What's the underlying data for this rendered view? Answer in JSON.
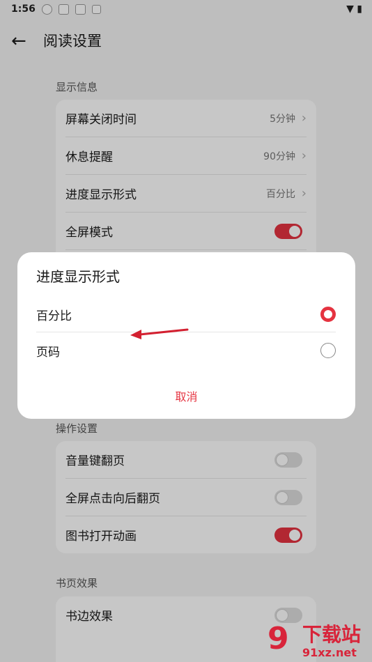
{
  "status": {
    "time": "1:56"
  },
  "header": {
    "title": "阅读设置"
  },
  "display": {
    "label": "显示信息",
    "items": [
      {
        "label": "屏幕关闭时间",
        "value": "5分钟"
      },
      {
        "label": "休息提醒",
        "value": "90分钟"
      },
      {
        "label": "进度显示形式",
        "value": "百分比"
      },
      {
        "label": "全屏模式",
        "switch": "on"
      }
    ]
  },
  "operation": {
    "label": "操作设置",
    "items": [
      {
        "label": "音量键翻页",
        "switch": "off"
      },
      {
        "label": "全屏点击向后翻页",
        "switch": "off"
      },
      {
        "label": "图书打开动画",
        "switch": "on"
      }
    ]
  },
  "page_effect": {
    "label": "书页效果",
    "items": [
      {
        "label": "书边效果",
        "switch": "off"
      }
    ]
  },
  "dialog": {
    "title": "进度显示形式",
    "options": [
      {
        "label": "百分比",
        "selected": true
      },
      {
        "label": "页码",
        "selected": false
      }
    ],
    "cancel": "取消"
  },
  "watermark": {
    "brand": "下载站",
    "url": "91xz.net",
    "logo": "9"
  },
  "colors": {
    "accent": "#e53340"
  }
}
